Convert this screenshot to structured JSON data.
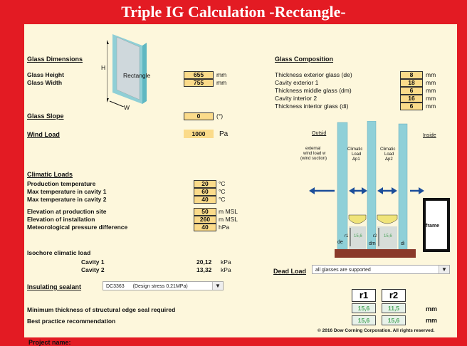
{
  "title": "Triple IG Calculation -Rectangle-",
  "glass_dimensions": {
    "heading": "Glass Dimensions",
    "diagram": {
      "h": "H",
      "w": "W",
      "label": "Rectangle"
    },
    "height_label": "Glass Height",
    "height_value": "655",
    "height_unit": "mm",
    "width_label": "Glass Width",
    "width_value": "755",
    "width_unit": "mm"
  },
  "glass_slope": {
    "label": "Glass Slope",
    "value": "0",
    "unit": "(°)"
  },
  "wind_load": {
    "label": "Wind Load",
    "value": "1000",
    "unit": "Pa"
  },
  "climatic_loads": {
    "heading": "Climatic Loads",
    "rows": [
      {
        "label": "Production temperature",
        "value": "20",
        "unit": "°C"
      },
      {
        "label": "Max temperature in cavity 1",
        "value": "60",
        "unit": "°C"
      },
      {
        "label": "Max temperature in cavity 2",
        "value": "40",
        "unit": "°C"
      }
    ],
    "rows2": [
      {
        "label": "Elevation at production site",
        "value": "50",
        "unit": "m MSL"
      },
      {
        "label": "Elevation of installation",
        "value": "260",
        "unit": "m MSL"
      },
      {
        "label": "Meteorological pressure difference",
        "value": "40",
        "unit": "hPa"
      }
    ]
  },
  "isochore": {
    "heading": "Isochore climatic load",
    "rows": [
      {
        "label": "Cavity 1",
        "value": "20,12",
        "unit": "kPa"
      },
      {
        "label": "Cavity 2",
        "value": "13,32",
        "unit": "kPa"
      }
    ]
  },
  "sealant": {
    "label": "Insulating sealant",
    "value": "DC3363",
    "note": "(Design stress 0.21MPa)"
  },
  "glass_composition": {
    "heading": "Glass Composition",
    "rows": [
      {
        "label": "Thickness exterior glass (de)",
        "value": "8",
        "unit": "mm"
      },
      {
        "label": "Cavity exterior 1",
        "value": "18",
        "unit": "mm"
      },
      {
        "label": "Thickness middle glass (dm)",
        "value": "6",
        "unit": "mm"
      },
      {
        "label": "Cavity interior 2",
        "value": "16",
        "unit": "mm"
      },
      {
        "label": "Thickness interior glass (di)",
        "value": "6",
        "unit": "mm"
      }
    ]
  },
  "cross_section": {
    "outside": "Outsid",
    "inside": "Inside",
    "wind_text": [
      "external",
      "wind load w",
      "(wind suction)"
    ],
    "climatic1": [
      "Climatic",
      "Load",
      "Δp1"
    ],
    "climatic2": [
      "Climatic",
      "Load",
      "Δp2"
    ],
    "frame": "frame",
    "de": "de",
    "dm": "dm",
    "di": "di",
    "r1": "r1",
    "r2": "r2",
    "r1_val": "15,6",
    "r2_val": "15,6"
  },
  "dead_load": {
    "label": "Dead Load",
    "value": "all glasses are supported"
  },
  "results": {
    "r1_label": "r1",
    "r2_label": "r2",
    "min_label": "Minimum thickness of structural edge seal required",
    "min_r1": "15,6",
    "min_r2": "11,5",
    "min_unit": "mm",
    "best_label": "Best practice recommendation",
    "best_r1": "15,6",
    "best_r2": "15,6",
    "best_unit": "mm"
  },
  "copyright": "© 2016 Dow Corning Corporation. All rights reserved.",
  "project_name": "Project name:"
}
